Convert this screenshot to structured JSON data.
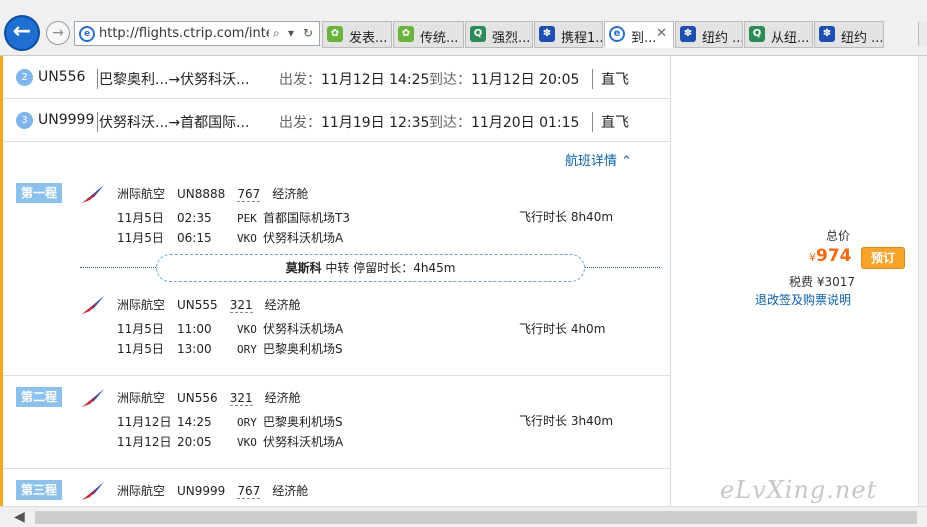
{
  "browser": {
    "url": "http://flights.ctrip.com/interr",
    "tabs": [
      {
        "label": "发表...",
        "icon": "leaf-icon",
        "color": "#6ab43e",
        "active": false
      },
      {
        "label": "传统...",
        "icon": "leaf-icon",
        "color": "#6ab43e",
        "active": false
      },
      {
        "label": "强烈...",
        "icon": "q-icon",
        "color": "#2e8b57",
        "active": false
      },
      {
        "label": "携程1...",
        "icon": "paw-icon",
        "color": "#1e4fb0",
        "active": false
      },
      {
        "label": "到...",
        "icon": "e-icon",
        "color": "#2c6fc9",
        "active": true
      },
      {
        "label": "纽约 ...",
        "icon": "paw-icon",
        "color": "#1e4fb0",
        "active": false
      },
      {
        "label": "从纽...",
        "icon": "q-icon",
        "color": "#2e8b57",
        "active": false
      },
      {
        "label": "纽约 ...",
        "icon": "paw-icon",
        "color": "#1e4fb0",
        "active": false
      }
    ]
  },
  "summary_rows": [
    {
      "num": "2",
      "flight": "UN556",
      "route": "巴黎奥利...→伏努科沃...",
      "dep_label": "出发：",
      "dep": "11月12日 14:25",
      "arr_label": "到达：",
      "arr": "11月12日 20:05",
      "direct": "直飞"
    },
    {
      "num": "3",
      "flight": "UN9999",
      "route": "伏努科沃...→首都国际...",
      "dep_label": "出发：",
      "dep": "11月19日 12:35",
      "arr_label": "到达：",
      "arr": "11月20日 01:15",
      "direct": "直飞"
    }
  ],
  "detail_link": "航班详情",
  "segments": [
    {
      "tag": "第一程",
      "flights": [
        {
          "airline": "洲际航空",
          "flight": "UN8888",
          "aircraft": "767",
          "cabin": "经济舱",
          "dep": {
            "date": "11月5日",
            "time": "02:35",
            "code": "PEK",
            "airport": "首都国际机场T3"
          },
          "arr": {
            "date": "11月5日",
            "time": "06:15",
            "code": "VKO",
            "airport": "伏努科沃机场A"
          },
          "duration": "飞行时长 8h40m"
        },
        {
          "airline": "洲际航空",
          "flight": "UN555",
          "aircraft": "321",
          "cabin": "经济舱",
          "dep": {
            "date": "11月5日",
            "time": "11:00",
            "code": "VKO",
            "airport": "伏努科沃机场A"
          },
          "arr": {
            "date": "11月5日",
            "time": "13:00",
            "code": "ORY",
            "airport": "巴黎奥利机场S"
          },
          "duration": "飞行时长 4h0m"
        }
      ],
      "transfer": {
        "city": "莫斯科",
        "text": "中转 停留时长：4h45m"
      }
    },
    {
      "tag": "第二程",
      "flights": [
        {
          "airline": "洲际航空",
          "flight": "UN556",
          "aircraft": "321",
          "cabin": "经济舱",
          "dep": {
            "date": "11月12日",
            "time": "14:25",
            "code": "ORY",
            "airport": "巴黎奥利机场S"
          },
          "arr": {
            "date": "11月12日",
            "time": "20:05",
            "code": "VKO",
            "airport": "伏努科沃机场A"
          },
          "duration": "飞行时长 3h40m"
        }
      ]
    },
    {
      "tag": "第三程",
      "flights": [
        {
          "airline": "洲际航空",
          "flight": "UN9999",
          "aircraft": "767",
          "cabin": "经济舱"
        }
      ]
    }
  ],
  "pricing": {
    "total_label": "总价",
    "currency": "¥",
    "price": "974",
    "book": "预订",
    "tax": "税费 ¥3017",
    "refund": "退改签及购票说明"
  },
  "watermark": "eLvXing.net",
  "colors": {
    "accent": "#f26a14",
    "link": "#0a5fa8",
    "tag": "#8cc1ec"
  }
}
